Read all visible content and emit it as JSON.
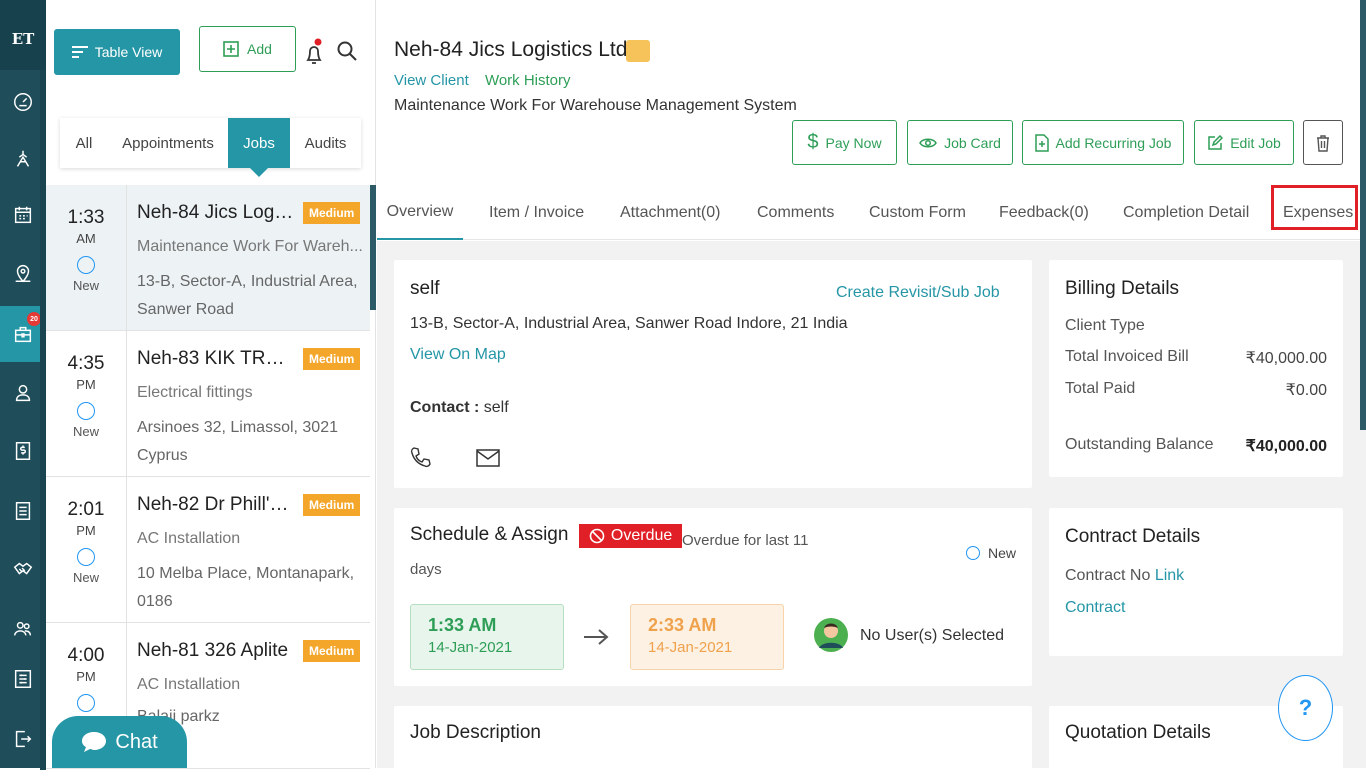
{
  "app": {
    "logo": "ET"
  },
  "rail": {
    "active_badge": "20"
  },
  "list": {
    "table_view_label": "Table View",
    "add_label": "Add",
    "tabs": [
      {
        "label": "All"
      },
      {
        "label": "Appointments"
      },
      {
        "label": "Jobs"
      },
      {
        "label": "Audits"
      }
    ],
    "active_tab": "Jobs",
    "jobs": [
      {
        "time": "1:33",
        "ampm": "AM",
        "status": "New",
        "title": "Neh-84 Jics Logist...",
        "priority": "Medium",
        "subtitle": "Maintenance Work For Wareh...",
        "address": "13-B, Sector-A, Industrial Area, Sanwer Road"
      },
      {
        "time": "4:35",
        "ampm": "PM",
        "status": "New",
        "title": "Neh-83 KIK TRAD...",
        "priority": "Medium",
        "subtitle": "Electrical fittings",
        "address": "Arsinoes 32, Limassol, 3021 Cyprus"
      },
      {
        "time": "2:01",
        "ampm": "PM",
        "status": "New",
        "title": "Neh-82 Dr Phill's ...",
        "priority": "Medium",
        "subtitle": "AC Installation",
        "address": "10 Melba Place, Montanapark, 0186"
      },
      {
        "time": "4:00",
        "ampm": "PM",
        "status": "",
        "title": "Neh-81 326 Aplite",
        "priority": "Medium",
        "subtitle": "AC Installation",
        "address": "Balaji parkz"
      }
    ],
    "chat_label": "Chat"
  },
  "header": {
    "title": "Neh-84 Jics Logistics Ltd",
    "view_client": "View Client",
    "work_history": "Work History",
    "description": "Maintenance Work For Warehouse Management System",
    "actions": {
      "pay_now": "Pay Now",
      "job_card": "Job Card",
      "add_recurring": "Add Recurring Job",
      "edit_job": "Edit Job"
    }
  },
  "tabs": [
    {
      "label": "Overview"
    },
    {
      "label": "Item / Invoice"
    },
    {
      "label": "Attachment(0)"
    },
    {
      "label": "Comments"
    },
    {
      "label": "Custom Form"
    },
    {
      "label": "Feedback(0)"
    },
    {
      "label": "Completion Detail"
    },
    {
      "label": "Expenses"
    }
  ],
  "client_card": {
    "name": "self",
    "create_revisit": "Create Revisit/Sub Job",
    "address": "13-B, Sector-A, Industrial Area, Sanwer Road Indore, 21 India",
    "view_on_map": "View On Map",
    "contact_label": "Contact :",
    "contact_value": "self"
  },
  "billing": {
    "title": "Billing Details",
    "client_type_label": "Client Type",
    "total_invoiced_label": "Total Invoiced Bill",
    "total_invoiced_value": "₹40,000.00",
    "total_paid_label": "Total Paid",
    "total_paid_value": "₹0.00",
    "outstanding_label": "Outstanding Balance",
    "outstanding_value": "₹40,000.00"
  },
  "schedule": {
    "title": "Schedule & Assign",
    "overdue_badge": "Overdue",
    "overdue_text": "Overdue for last 11",
    "overdue_unit": "days",
    "status": "New",
    "start_time": "1:33 AM",
    "start_date": "14-Jan-2021",
    "end_time": "2:33 AM",
    "end_date": "14-Jan-2021",
    "assignee": "No User(s) Selected"
  },
  "contract": {
    "title": "Contract Details",
    "label": "Contract No",
    "link": "Link",
    "contract_link": "Contract"
  },
  "job_description": {
    "title": "Job Description"
  },
  "quotation": {
    "title": "Quotation Details"
  },
  "help_label": "?",
  "colors": {
    "primary": "#2596a6",
    "success": "#2e9e57",
    "danger": "#e01f26",
    "warning": "#f4a62a",
    "sidebar": "#1f4d5a"
  }
}
